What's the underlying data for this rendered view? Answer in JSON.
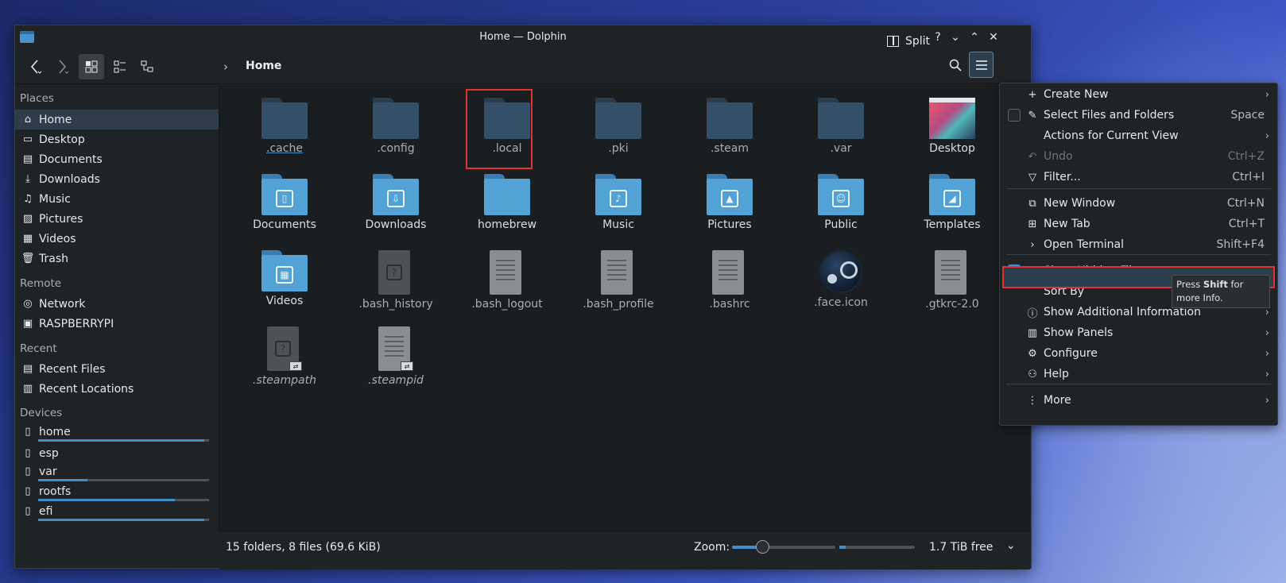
{
  "window": {
    "title": "Home — Dolphin",
    "controls": [
      "?",
      "⌄",
      "⌃",
      "✕"
    ]
  },
  "toolbar": {
    "back_icon": "back-icon",
    "forward_icon": "forward-icon",
    "breadcrumb_sep": "›",
    "breadcrumb": "Home",
    "split_label": "Split",
    "search_icon": "search-icon",
    "menu_icon": "hamburger-icon"
  },
  "sidebar": {
    "places_head": "Places",
    "places": [
      {
        "label": "Home",
        "icon": "home-icon",
        "selected": true
      },
      {
        "label": "Desktop",
        "icon": "desktop-icon"
      },
      {
        "label": "Documents",
        "icon": "documents-icon"
      },
      {
        "label": "Downloads",
        "icon": "downloads-icon"
      },
      {
        "label": "Music",
        "icon": "music-icon"
      },
      {
        "label": "Pictures",
        "icon": "pictures-icon"
      },
      {
        "label": "Videos",
        "icon": "videos-icon"
      },
      {
        "label": "Trash",
        "icon": "trash-icon"
      }
    ],
    "remote_head": "Remote",
    "remote": [
      {
        "label": "Network",
        "icon": "network-icon"
      },
      {
        "label": "RASPBERRYPI",
        "icon": "network-share-icon"
      }
    ],
    "recent_head": "Recent",
    "recent": [
      {
        "label": "Recent Files",
        "icon": "recent-files-icon"
      },
      {
        "label": "Recent Locations",
        "icon": "recent-locations-icon"
      }
    ],
    "devices_head": "Devices",
    "devices": [
      {
        "label": "home",
        "icon": "drive-icon",
        "usage": 0.97
      },
      {
        "label": "esp",
        "icon": "drive-locked-icon",
        "usage": null
      },
      {
        "label": "var",
        "icon": "drive-icon",
        "usage": 0.29
      },
      {
        "label": "rootfs",
        "icon": "drive-icon",
        "usage": 0.8
      },
      {
        "label": "efi",
        "icon": "drive-icon",
        "usage": 0.97
      }
    ]
  },
  "files": [
    {
      "name": ".cache",
      "kind": "hidden-folder"
    },
    {
      "name": ".config",
      "kind": "hidden-folder"
    },
    {
      "name": ".local",
      "kind": "hidden-folder"
    },
    {
      "name": ".pki",
      "kind": "hidden-folder"
    },
    {
      "name": ".steam",
      "kind": "hidden-folder"
    },
    {
      "name": ".var",
      "kind": "hidden-folder"
    },
    {
      "name": "Desktop",
      "kind": "image"
    },
    {
      "name": "Documents",
      "kind": "folder",
      "glyph": "▯"
    },
    {
      "name": "Downloads",
      "kind": "folder",
      "glyph": "⇩"
    },
    {
      "name": "homebrew",
      "kind": "folder",
      "glyph": ""
    },
    {
      "name": "Music",
      "kind": "folder",
      "glyph": "♪"
    },
    {
      "name": "Pictures",
      "kind": "folder",
      "glyph": "▲"
    },
    {
      "name": "Public",
      "kind": "folder",
      "glyph": "☺"
    },
    {
      "name": "Templates",
      "kind": "folder",
      "glyph": "◢"
    },
    {
      "name": "Videos",
      "kind": "folder",
      "glyph": "▦"
    },
    {
      "name": ".bash_history",
      "kind": "unknown-doc"
    },
    {
      "name": ".bash_logout",
      "kind": "text-doc"
    },
    {
      "name": ".bash_profile",
      "kind": "text-doc"
    },
    {
      "name": ".bashrc",
      "kind": "text-doc"
    },
    {
      "name": ".face.icon",
      "kind": "steam"
    },
    {
      "name": ".gtkrc-2.0",
      "kind": "text-doc"
    },
    {
      "name": ".steampath",
      "kind": "unknown-link"
    },
    {
      "name": ".steampid",
      "kind": "text-link"
    }
  ],
  "status": {
    "info": "15 folders, 8 files (69.6 KiB)",
    "zoom_label": "Zoom:",
    "zoom_level": 0.28,
    "free_space": "1.7 TiB free",
    "free_usage": 0.08
  },
  "menu": {
    "items": [
      {
        "label": "Create New",
        "icon": "plus-icon",
        "shortcut": "",
        "submenu": true
      },
      {
        "label": "Select Files and Folders",
        "icon": "select-icon",
        "shortcut": "Space",
        "checkbox": false
      },
      {
        "label": "Actions for Current View",
        "icon": "",
        "shortcut": "",
        "submenu": true
      },
      {
        "label": "Undo",
        "icon": "undo-icon",
        "shortcut": "Ctrl+Z",
        "disabled": true
      },
      {
        "label": "Filter...",
        "icon": "filter-icon",
        "shortcut": "Ctrl+I"
      },
      {
        "label": "New Window",
        "icon": "new-window-icon",
        "shortcut": "Ctrl+N"
      },
      {
        "label": "New Tab",
        "icon": "new-tab-icon",
        "shortcut": "Ctrl+T"
      },
      {
        "label": "Open Terminal",
        "icon": "terminal-icon",
        "shortcut": "Shift+F4"
      },
      {
        "label": "Show Hidden Files",
        "icon": "eye-icon",
        "shortcut": "",
        "checkbox": true
      },
      {
        "label": "Sort By",
        "icon": "",
        "shortcut": "",
        "submenu": true
      },
      {
        "label": "Show Additional Information",
        "icon": "info-icon",
        "shortcut": "",
        "submenu": true
      },
      {
        "label": "Show Panels",
        "icon": "panels-icon",
        "shortcut": "",
        "submenu": true
      },
      {
        "label": "Configure",
        "icon": "configure-icon",
        "shortcut": "",
        "submenu": true
      },
      {
        "label": "Help",
        "icon": "help-icon",
        "shortcut": "",
        "submenu": true
      },
      {
        "label": "More",
        "icon": "more-icon",
        "shortcut": "",
        "submenu": true
      }
    ]
  },
  "tooltip": {
    "pre": "Press ",
    "key": "Shift",
    "post": " for more Info."
  },
  "colors": {
    "accent": "#3f8ec9",
    "highlight": "#e0332e",
    "window_bg": "#202326"
  }
}
